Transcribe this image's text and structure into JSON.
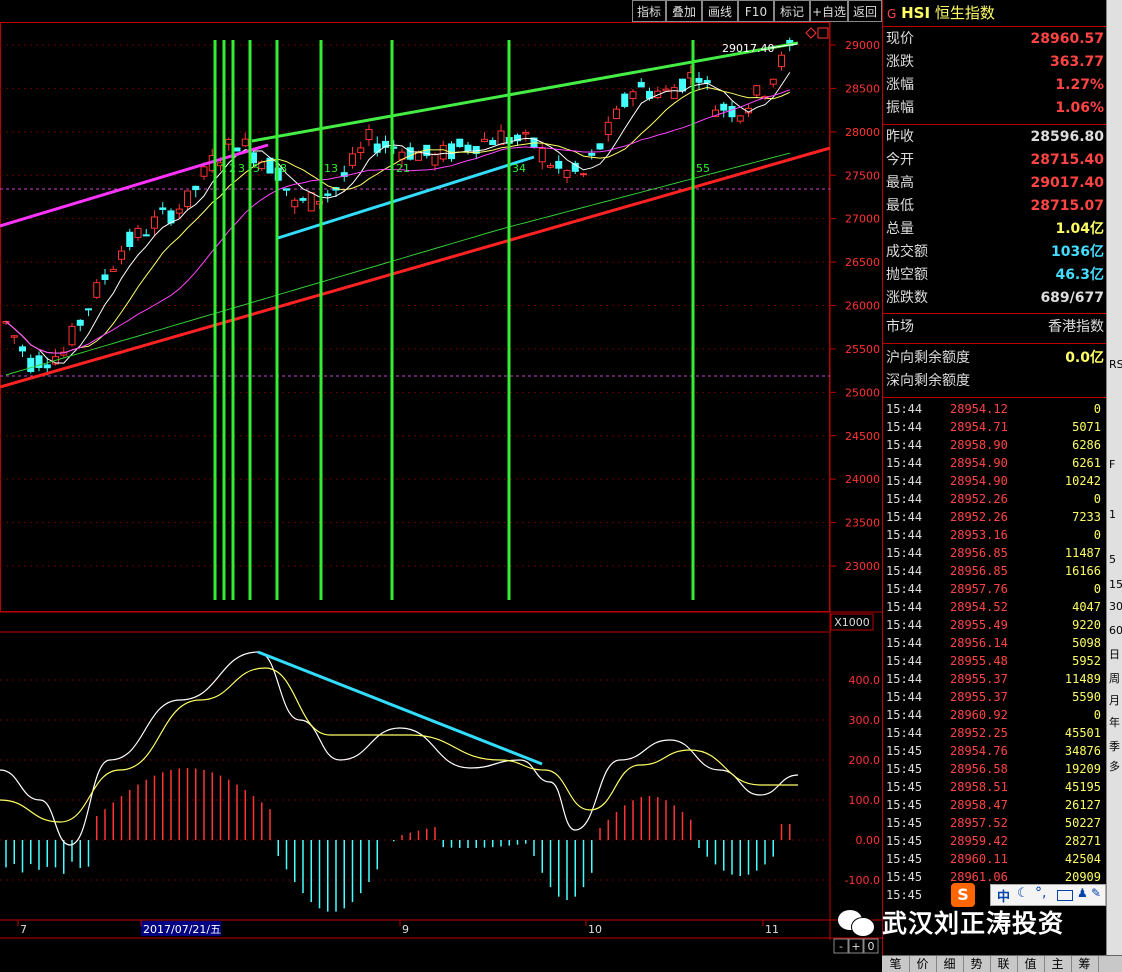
{
  "toolbar": {
    "buttons": [
      "指标",
      "叠加",
      "画线",
      "F10",
      "标记",
      "+自选",
      "返回"
    ]
  },
  "chart": {
    "top_right_value": "29017.40",
    "price_ticks": [
      "29000",
      "28500",
      "28000",
      "27500",
      "27000",
      "26500",
      "26000",
      "25500",
      "25000",
      "24500",
      "24000",
      "23500",
      "23000"
    ],
    "macd_unit": "X1000",
    "macd_ticks": [
      "400.0",
      "300.0",
      "200.0",
      "100.0",
      "0.00",
      "-100.0"
    ],
    "cycle_labels": [
      "1",
      "2",
      "3",
      "5",
      "8",
      "13",
      "21",
      "34",
      "55"
    ],
    "date_labels": [
      "7",
      "2017/07/21/五",
      "9",
      "10",
      "11"
    ],
    "zoom_buttons": [
      "-",
      "+",
      "0"
    ]
  },
  "chart_data": {
    "type": "candlestick",
    "title": "HSI 恒生指数",
    "ylim": [
      22600,
      29300
    ],
    "annotation_max": "29017.40",
    "fibonacci_counts": [
      1,
      2,
      3,
      5,
      8,
      13,
      21,
      34,
      55
    ],
    "x_months": [
      "7",
      "8",
      "9",
      "10",
      "11"
    ],
    "highlight_date": "2017/07/21/五",
    "macd": {
      "ticks": [
        400,
        300,
        200,
        100,
        0,
        -100
      ],
      "unit": "X1000"
    }
  },
  "panel": {
    "code_prefix": "G",
    "code": "HSI",
    "name": "恒生指数",
    "quote": [
      {
        "label": "现价",
        "value": "28960.57",
        "color": "#ff4444"
      },
      {
        "label": "涨跌",
        "value": "363.77",
        "color": "#ff4444"
      },
      {
        "label": "涨幅",
        "value": "1.27%",
        "color": "#ff4444"
      },
      {
        "label": "振幅",
        "value": "1.06%",
        "color": "#ff4444"
      }
    ],
    "stats": [
      {
        "label": "昨收",
        "value": "28596.80",
        "color": "#dddddd"
      },
      {
        "label": "今开",
        "value": "28715.40",
        "color": "#ff4444"
      },
      {
        "label": "最高",
        "value": "29017.40",
        "color": "#ff4444"
      },
      {
        "label": "最低",
        "value": "28715.07",
        "color": "#ff4444"
      },
      {
        "label": "总量",
        "value": "1.04亿",
        "color": "#ffff66"
      },
      {
        "label": "成交额",
        "value": "1036亿",
        "color": "#44ddff"
      },
      {
        "label": "抛空额",
        "value": "46.3亿",
        "color": "#44ddff"
      },
      {
        "label": "涨跌数",
        "value": "689/677",
        "color": "#dddddd"
      }
    ],
    "market_label": "市场",
    "market_value": "香港指数",
    "quota": [
      {
        "label": "沪向剩余额度",
        "value": "0.0亿",
        "color": "#ffff66"
      },
      {
        "label": "深向剩余额度",
        "value": "",
        "color": "#ffff66"
      }
    ],
    "ticks": [
      [
        "15:44",
        "28954.12",
        "0"
      ],
      [
        "15:44",
        "28954.71",
        "5071"
      ],
      [
        "15:44",
        "28958.90",
        "6286"
      ],
      [
        "15:44",
        "28954.90",
        "6261"
      ],
      [
        "15:44",
        "28954.90",
        "10242"
      ],
      [
        "15:44",
        "28952.26",
        "0"
      ],
      [
        "15:44",
        "28952.26",
        "7233"
      ],
      [
        "15:44",
        "28953.16",
        "0"
      ],
      [
        "15:44",
        "28956.85",
        "11487"
      ],
      [
        "15:44",
        "28956.85",
        "16166"
      ],
      [
        "15:44",
        "28957.76",
        "0"
      ],
      [
        "15:44",
        "28954.52",
        "4047"
      ],
      [
        "15:44",
        "28955.49",
        "9220"
      ],
      [
        "15:44",
        "28956.14",
        "5098"
      ],
      [
        "15:44",
        "28955.48",
        "5952"
      ],
      [
        "15:44",
        "28955.37",
        "11489"
      ],
      [
        "15:44",
        "28955.37",
        "5590"
      ],
      [
        "15:44",
        "28960.92",
        "0"
      ],
      [
        "15:44",
        "28952.25",
        "45501"
      ],
      [
        "15:45",
        "28954.76",
        "34876"
      ],
      [
        "15:45",
        "28956.58",
        "19209"
      ],
      [
        "15:45",
        "28958.51",
        "45195"
      ],
      [
        "15:45",
        "28958.47",
        "26127"
      ],
      [
        "15:45",
        "28957.52",
        "50227"
      ],
      [
        "15:45",
        "28959.42",
        "28271"
      ],
      [
        "15:45",
        "28960.11",
        "42504"
      ],
      [
        "15:45",
        "28961.06",
        "20909"
      ],
      [
        "15:45",
        "",
        ""
      ]
    ]
  },
  "bottom_tabs": [
    "笔",
    "价",
    "细",
    "势",
    "联",
    "值",
    "主",
    "筹"
  ],
  "right_strip": [
    "RS",
    "F",
    "1",
    "5",
    "15",
    "30",
    "60",
    "日",
    "周",
    "月",
    "年",
    "季",
    "多"
  ],
  "ime_label": "中",
  "watermark": "武汉刘正涛投资"
}
